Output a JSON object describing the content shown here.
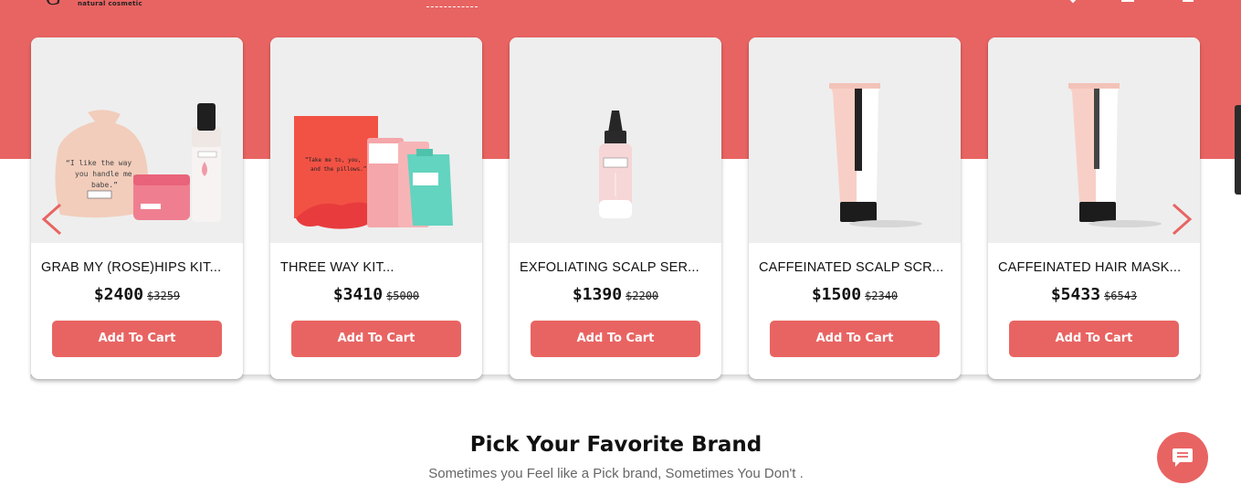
{
  "header": {
    "logo_script": "G",
    "logo_tagline": "natural cosmetic"
  },
  "products": [
    {
      "name": "GRAB MY (ROSE)HIPS KIT...",
      "price": "$2400",
      "old_price": "$3259",
      "button": "Add To Cart"
    },
    {
      "name": "THREE WAY KIT...",
      "price": "$3410",
      "old_price": "$5000",
      "button": "Add To Cart"
    },
    {
      "name": "EXFOLIATING SCALP SER...",
      "price": "$1390",
      "old_price": "$2200",
      "button": "Add To Cart"
    },
    {
      "name": "CAFFEINATED SCALP SCR...",
      "price": "$1500",
      "old_price": "$2340",
      "button": "Add To Cart"
    },
    {
      "name": "CAFFEINATED HAIR MASK...",
      "price": "$5433",
      "old_price": "$6543",
      "button": "Add To Cart"
    }
  ],
  "section": {
    "title": "Pick Your Favorite Brand",
    "subtitle": "Sometimes you Feel like a Pick brand, Sometimes You Don't ."
  },
  "icons": {
    "prev": "chevron-left-icon",
    "next": "chevron-right-icon",
    "chat": "chat-bubble-icon"
  },
  "colors": {
    "accent": "#e86462",
    "card_image_bg": "#eeeeee"
  }
}
